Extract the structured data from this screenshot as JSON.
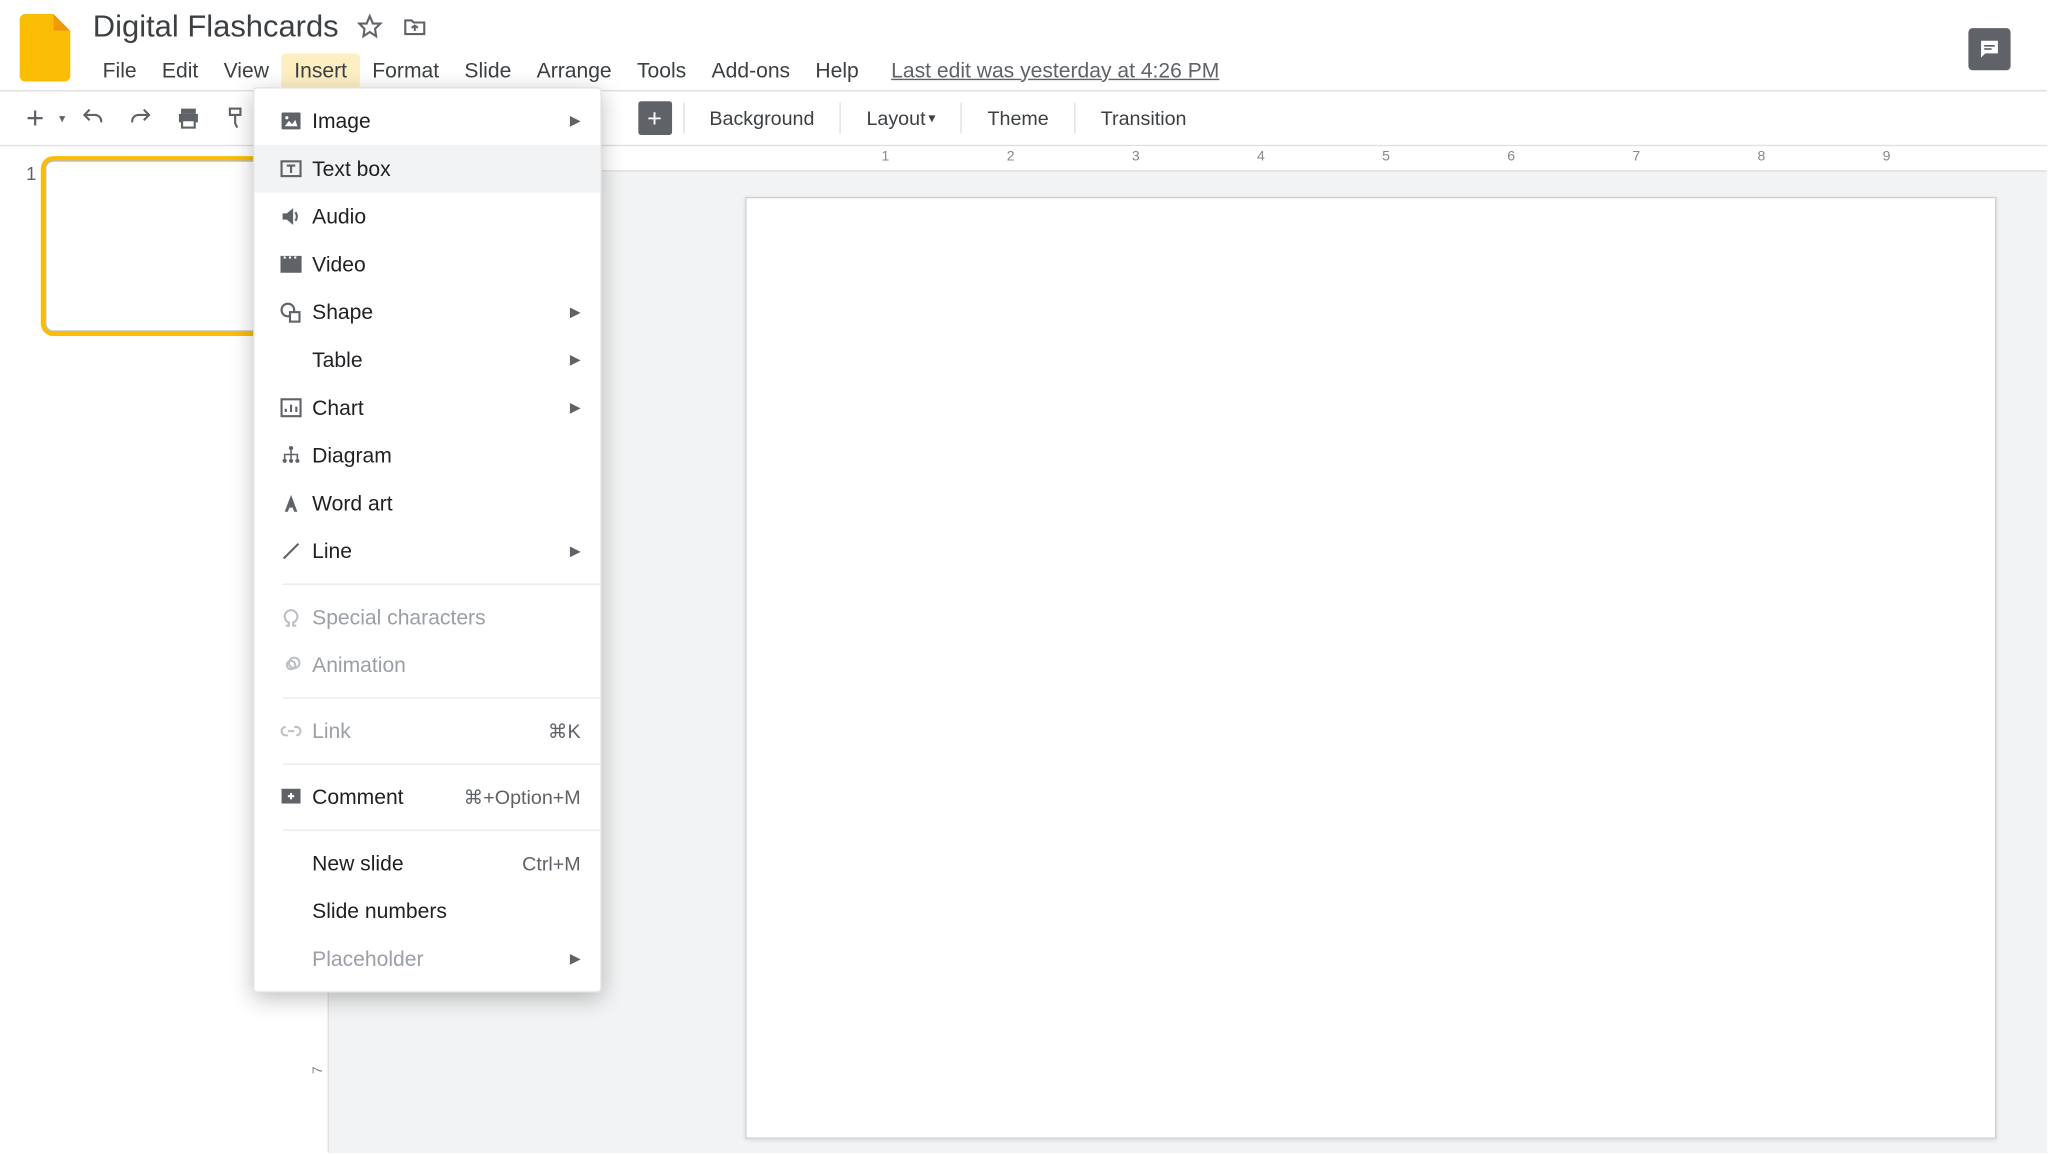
{
  "doc": {
    "title": "Digital Flashcards"
  },
  "menus": {
    "file": "File",
    "edit": "Edit",
    "view": "View",
    "insert": "Insert",
    "format": "Format",
    "slide": "Slide",
    "arrange": "Arrange",
    "tools": "Tools",
    "addons": "Add-ons",
    "help": "Help",
    "last_edit": "Last edit was yesterday at 4:26 PM"
  },
  "toolbar": {
    "background": "Background",
    "layout": "Layout",
    "theme": "Theme",
    "transition": "Transition"
  },
  "insert_menu": {
    "image": "Image",
    "textbox": "Text box",
    "audio": "Audio",
    "video": "Video",
    "shape": "Shape",
    "table": "Table",
    "chart": "Chart",
    "diagram": "Diagram",
    "wordart": "Word art",
    "line": "Line",
    "special": "Special characters",
    "animation": "Animation",
    "link": "Link",
    "link_sc": "⌘K",
    "comment": "Comment",
    "comment_sc": "⌘+Option+M",
    "newslide": "New slide",
    "newslide_sc": "Ctrl+M",
    "slidenumbers": "Slide numbers",
    "placeholder": "Placeholder"
  },
  "ruler": {
    "h": [
      "1",
      "2",
      "3",
      "4",
      "5",
      "6",
      "7",
      "8",
      "9"
    ],
    "v": [
      "7"
    ]
  },
  "slide_panel": {
    "num": "1"
  }
}
